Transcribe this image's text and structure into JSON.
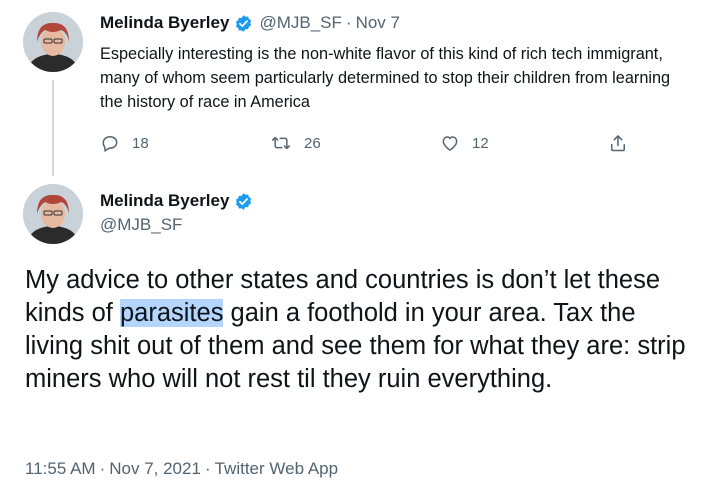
{
  "parent_tweet": {
    "author_name": "Melinda Byerley",
    "handle": "@MJB_SF",
    "separator": "·",
    "time": "Nov 7",
    "text": "Especially interesting is the non-white flavor of this kind of rich tech immigrant, many of whom seem particularly determined to stop their children from learning the history of race in America",
    "actions": {
      "reply_count": "18",
      "retweet_count": "26",
      "like_count": "12"
    },
    "icons": [
      "verified-badge-icon",
      "reply-icon",
      "retweet-icon",
      "like-icon",
      "share-icon"
    ]
  },
  "main_tweet": {
    "author_name": "Melinda Byerley",
    "handle": "@MJB_SF",
    "text_before": "My advice to other states and countries is don’t let these kinds of ",
    "text_highlight": "parasites",
    "text_after": " gain a foothold in your area. Tax the living shit out of them and see them for what they are: strip miners who will not rest til they ruin everything.",
    "meta": {
      "time": "11:55 AM",
      "date": "Nov 7, 2021",
      "source": "Twitter Web App",
      "separator": "·"
    }
  },
  "colors": {
    "text": "#0f1419",
    "secondary_text": "#536471",
    "verified_blue": "#1d9bf0",
    "selection_highlight": "#b4d5fe",
    "thread_line": "#cfd9de"
  }
}
